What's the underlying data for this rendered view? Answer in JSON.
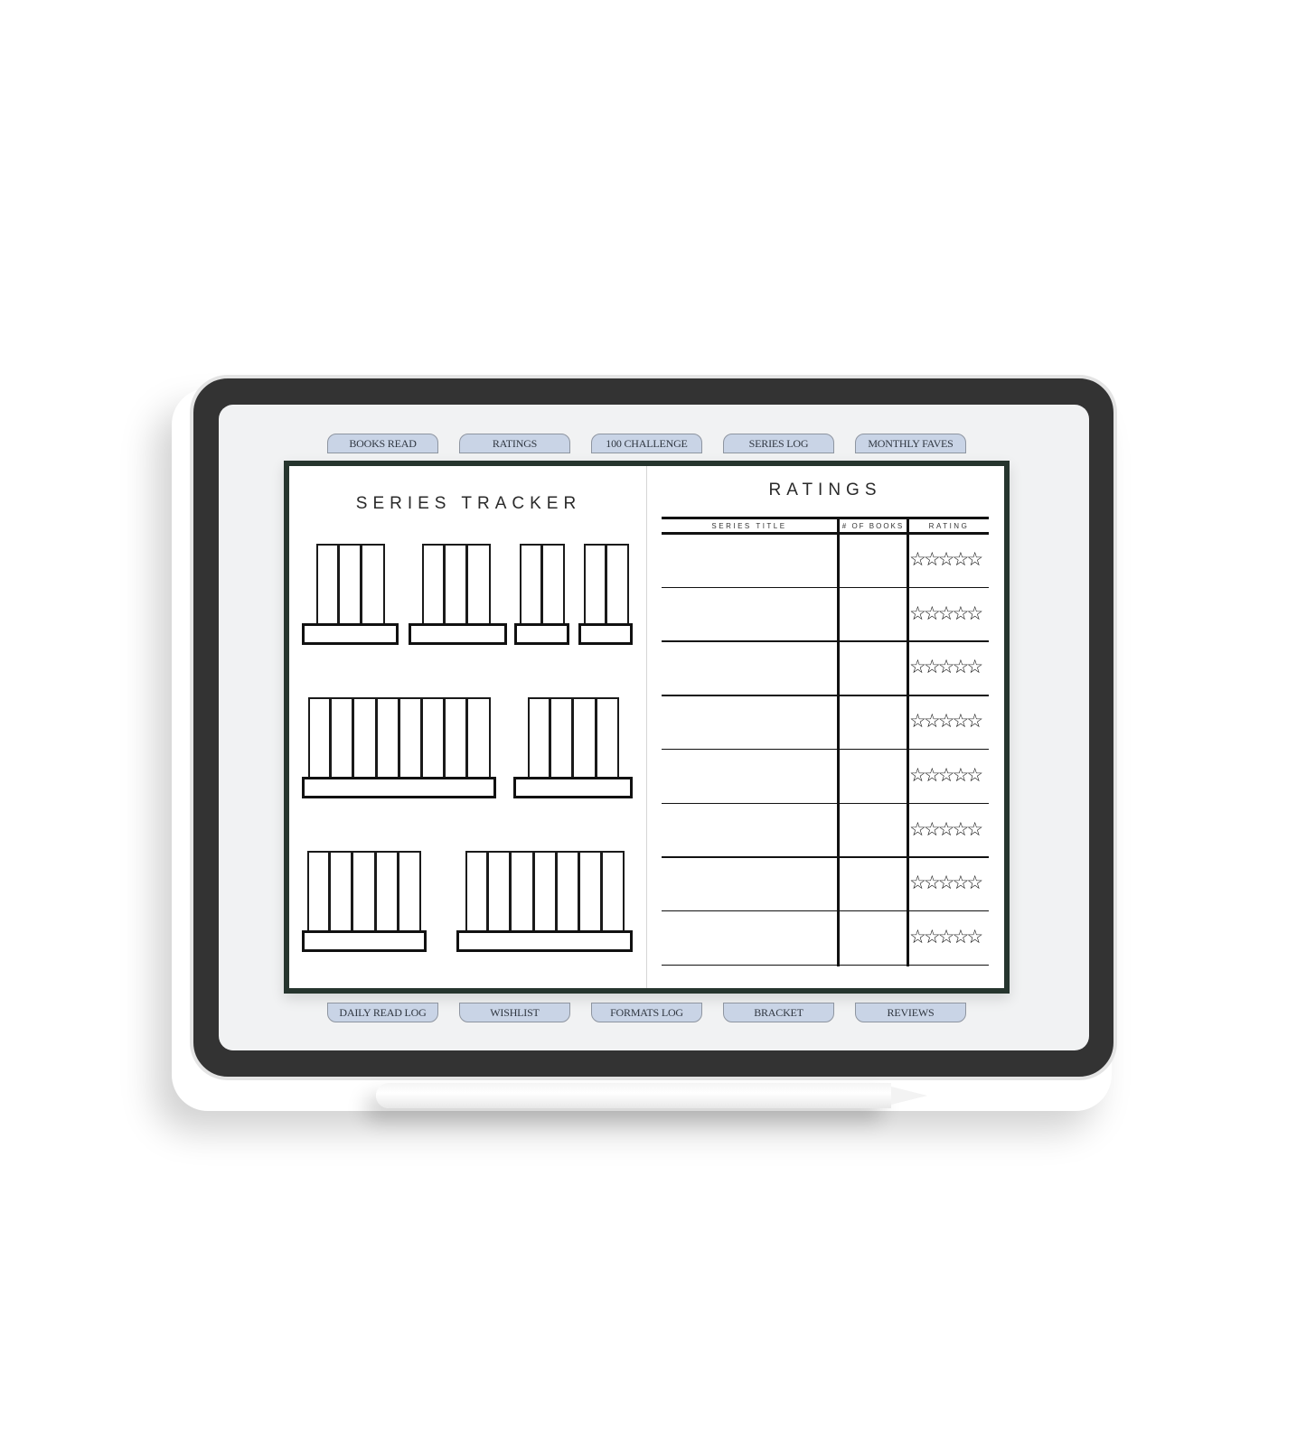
{
  "top_tabs": [
    {
      "label": "BOOKS READ"
    },
    {
      "label": "RATINGS"
    },
    {
      "label": "100 CHALLENGE"
    },
    {
      "label": "SERIES LOG"
    },
    {
      "label": "MONTHLY FAVES"
    }
  ],
  "bottom_tabs": [
    {
      "label": "DAILY READ LOG"
    },
    {
      "label": "WISHLIST"
    },
    {
      "label": "FORMATS LOG"
    },
    {
      "label": "BRACKET"
    },
    {
      "label": "REVIEWS"
    }
  ],
  "left_page": {
    "title": "SERIES TRACKER",
    "shelves": [
      {
        "row": 1,
        "books": 3
      },
      {
        "row": 1,
        "books": 3
      },
      {
        "row": 1,
        "books": 2
      },
      {
        "row": 1,
        "books": 2
      },
      {
        "row": 2,
        "books": 8
      },
      {
        "row": 2,
        "books": 4
      },
      {
        "row": 3,
        "books": 5
      },
      {
        "row": 3,
        "books": 7
      }
    ]
  },
  "right_page": {
    "title": "RATINGS",
    "columns": [
      "SERIES TITLE",
      "# OF BOOKS",
      "RATING"
    ],
    "rows": [
      {
        "series_title": "",
        "num_books": "",
        "rating": 0
      },
      {
        "series_title": "",
        "num_books": "",
        "rating": 0
      },
      {
        "series_title": "",
        "num_books": "",
        "rating": 0
      },
      {
        "series_title": "",
        "num_books": "",
        "rating": 0
      },
      {
        "series_title": "",
        "num_books": "",
        "rating": 0
      },
      {
        "series_title": "",
        "num_books": "",
        "rating": 0
      },
      {
        "series_title": "",
        "num_books": "",
        "rating": 0
      },
      {
        "series_title": "",
        "num_books": "",
        "rating": 0
      }
    ],
    "star_empty": "☆☆☆☆☆",
    "max_stars": 5
  },
  "colors": {
    "tab_fill": "#c9d4e6",
    "page_frame": "#26352e",
    "bezel": "#333333"
  }
}
